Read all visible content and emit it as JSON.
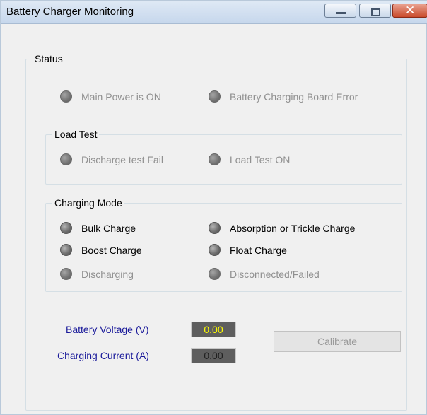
{
  "window": {
    "title": "Battery Charger Monitoring",
    "controls": {
      "minimize": "minimize",
      "maximize": "maximize",
      "close": "✕"
    }
  },
  "status": {
    "label": "Status",
    "indicators": [
      {
        "label": "Main Power is ON",
        "state": "off"
      },
      {
        "label": "Battery Charging Board Error",
        "state": "off"
      }
    ]
  },
  "load_test": {
    "label": "Load Test",
    "indicators": [
      {
        "label": "Discharge test Fail",
        "state": "off"
      },
      {
        "label": "Load Test ON",
        "state": "off"
      }
    ]
  },
  "charging_mode": {
    "label": "Charging Mode",
    "indicators": [
      {
        "label": "Bulk Charge",
        "state": "off"
      },
      {
        "label": "Absorption or Trickle Charge",
        "state": "off"
      },
      {
        "label": "Boost Charge",
        "state": "off"
      },
      {
        "label": "Float Charge",
        "state": "off"
      },
      {
        "label": "Discharging",
        "state": "off"
      },
      {
        "label": "Disconnected/Failed",
        "state": "off"
      }
    ]
  },
  "readings": {
    "voltage_label": "Battery Voltage (V)",
    "voltage_value": "0.00",
    "voltage_color": "#ffff00",
    "current_label": "Charging Current (A)",
    "current_value": "0.00",
    "current_color": "#1e1e1e"
  },
  "calibrate_label": "Calibrate"
}
